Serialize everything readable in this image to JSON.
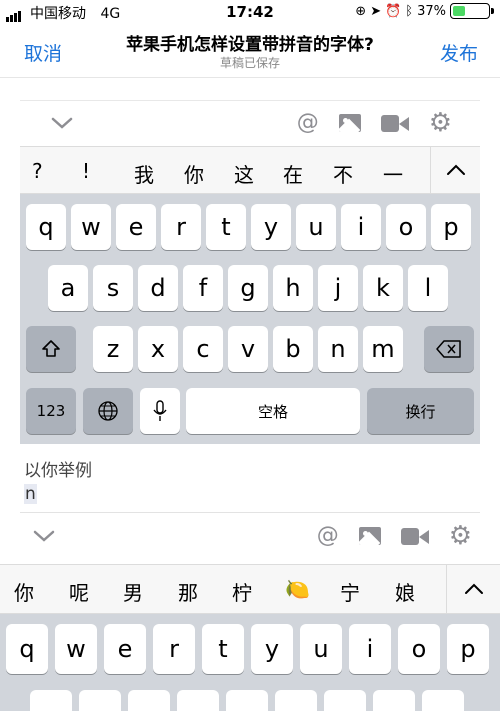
{
  "status": {
    "carrier": "中国移动",
    "network": "4G",
    "time": "17:42",
    "battery_percent_text": "37%",
    "battery_level": 0.37
  },
  "nav": {
    "cancel": "取消",
    "title": "苹果手机怎样设置带拼音的字体?",
    "subtitle": "草稿已保存",
    "publish": "发布"
  },
  "toolbar": {
    "icons": [
      "chevron-down-icon",
      "at-icon",
      "image-icon",
      "video-icon",
      "gear-icon"
    ],
    "at": "@"
  },
  "candidates_top": [
    "?",
    "!",
    "我",
    "你",
    "这",
    "在",
    "不",
    "一"
  ],
  "keyboard_top": {
    "row1": [
      "q",
      "w",
      "e",
      "r",
      "t",
      "y",
      "u",
      "i",
      "o",
      "p"
    ],
    "row2": [
      "a",
      "s",
      "d",
      "f",
      "g",
      "h",
      "j",
      "k",
      "l"
    ],
    "row3": [
      "z",
      "x",
      "c",
      "v",
      "b",
      "n",
      "m"
    ],
    "numbers": "123",
    "space": "空格",
    "return": "换行"
  },
  "example": {
    "label": "以你举例",
    "typed": "n"
  },
  "candidates_bottom": [
    "你",
    "呢",
    "男",
    "那",
    "柠",
    "🍋",
    "宁",
    "娘"
  ],
  "keyboard_bottom": {
    "row1": [
      "q",
      "w",
      "e",
      "r",
      "t",
      "y",
      "u",
      "i",
      "o",
      "p"
    ]
  },
  "colors": {
    "accent": "#1e74d9",
    "keyboard_bg": "#d1d5db",
    "dark_key": "#abb1ba"
  }
}
